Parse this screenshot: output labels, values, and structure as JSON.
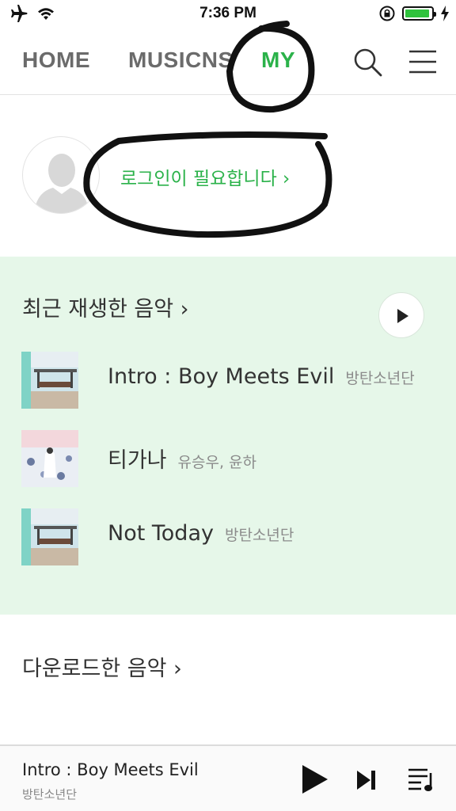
{
  "status_bar": {
    "time": "7:36 PM",
    "icons": [
      "airplane-icon",
      "wifi-icon",
      "rotation-lock-icon",
      "battery-icon",
      "charging-icon"
    ],
    "battery_level": 0.95,
    "battery_color": "#2fc23c"
  },
  "nav": {
    "tabs": [
      {
        "label": "HOME",
        "active": false
      },
      {
        "label": "MUSICNS",
        "active": false
      },
      {
        "label": "MY",
        "active": true
      }
    ],
    "icons": [
      "search-icon",
      "menu-icon"
    ],
    "accent_color": "#2bb24a"
  },
  "profile": {
    "login_prompt": "로그인이 필요합니다 ›"
  },
  "recent": {
    "title": "최근 재생한 음악 ›",
    "background": "#e6f7e9",
    "tracks": [
      {
        "title": "Intro : Boy Meets Evil",
        "artist": "방탄소년단"
      },
      {
        "title": "티가나",
        "artist": "유승우, 윤하"
      },
      {
        "title": "Not Today",
        "artist": "방탄소년단"
      }
    ]
  },
  "downloads": {
    "title": "다운로드한 음악 ›"
  },
  "player": {
    "title": "Intro : Boy Meets Evil",
    "artist": "방탄소년단",
    "icons": [
      "play-icon",
      "next-icon",
      "playlist-icon"
    ]
  }
}
